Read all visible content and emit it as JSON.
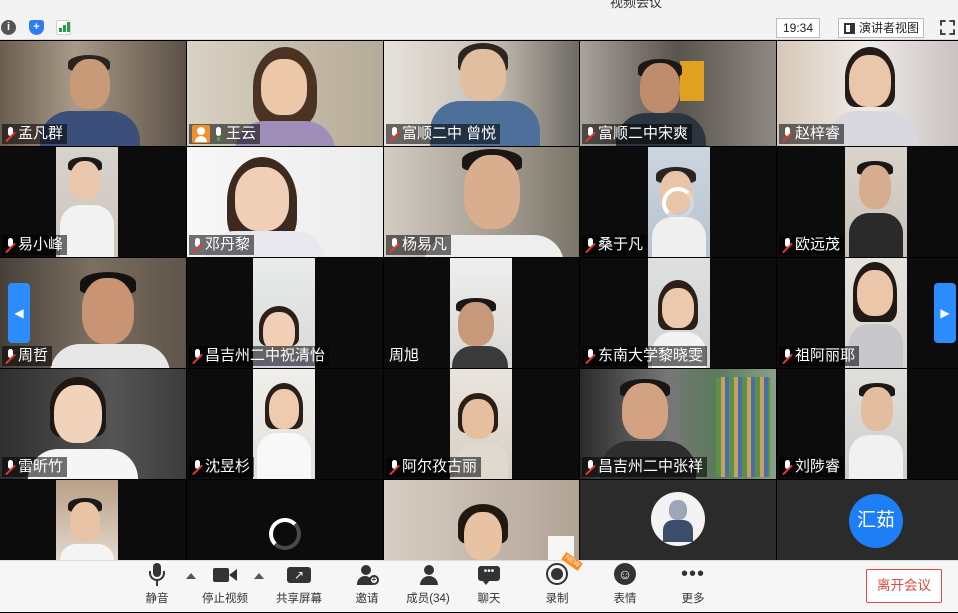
{
  "header": {
    "meeting_title": "视频会议",
    "clock": "19:34",
    "speaker_view_label": "演讲者视图",
    "icons": [
      "info-icon",
      "shield-icon",
      "signal-icon",
      "fullscreen-icon"
    ]
  },
  "participants": [
    {
      "name": "孟凡群",
      "mic": "muted"
    },
    {
      "name": "王云",
      "mic": "on",
      "host": true,
      "active": true
    },
    {
      "name": "富顺二中 曾悦",
      "mic": "muted"
    },
    {
      "name": "富顺二中宋爽",
      "mic": "muted"
    },
    {
      "name": "赵梓睿",
      "mic": "muted"
    },
    {
      "name": "易小峰",
      "mic": "muted"
    },
    {
      "name": "邓丹黎",
      "mic": "muted"
    },
    {
      "name": "杨易凡",
      "mic": "muted"
    },
    {
      "name": "桑于凡",
      "mic": "muted",
      "loading": true
    },
    {
      "name": "欧远茂",
      "mic": "muted"
    },
    {
      "name": "周哲",
      "mic": "muted"
    },
    {
      "name": "昌吉州二中祝清怡",
      "mic": "muted"
    },
    {
      "name": "周旭",
      "mic": "none"
    },
    {
      "name": "东南大学黎晓雯",
      "mic": "muted"
    },
    {
      "name": "祖阿丽耶",
      "mic": "muted"
    },
    {
      "name": "雷昕竹",
      "mic": "muted"
    },
    {
      "name": "沈昱杉",
      "mic": "muted"
    },
    {
      "name": "阿尔孜古丽",
      "mic": "muted"
    },
    {
      "name": "昌吉州二中张祥",
      "mic": "muted"
    },
    {
      "name": "刘陟睿",
      "mic": "muted"
    },
    {
      "name": "",
      "mic": "none"
    },
    {
      "name": "",
      "mic": "none",
      "loading": true
    },
    {
      "name": "",
      "mic": "none"
    },
    {
      "name": "",
      "mic": "none",
      "avatar": "photo"
    },
    {
      "name": "",
      "mic": "none",
      "avatar_text": "汇茹"
    }
  ],
  "toolbar": {
    "mute": "静音",
    "stop_video": "停止视频",
    "share_screen": "共享屏幕",
    "invite": "邀请",
    "members": "成员(34)",
    "chat": "聊天",
    "record": "录制",
    "record_badge": "NEW",
    "reactions": "表情",
    "more": "更多",
    "leave": "离开会议"
  },
  "colors": {
    "accent": "#2d8cff",
    "active_speaker": "#2fbf52",
    "leave": "#e04a3f",
    "muted": "#e53935"
  }
}
